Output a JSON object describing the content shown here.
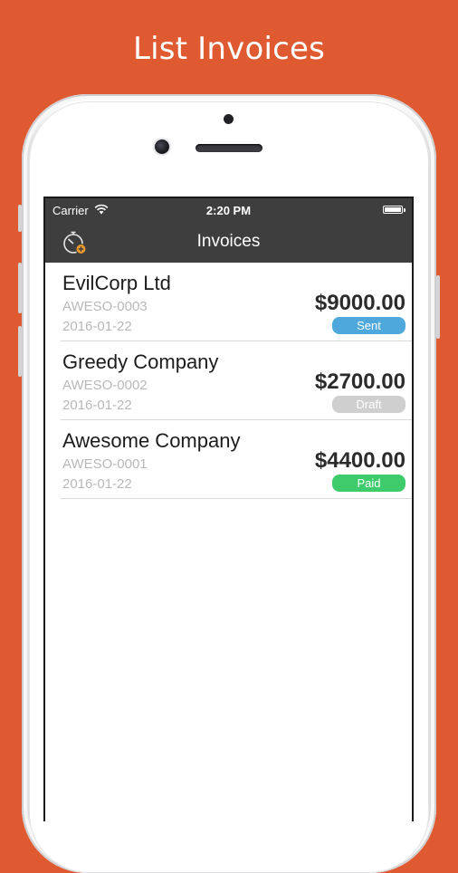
{
  "headline": "List Invoices",
  "status_bar": {
    "carrier": "Carrier",
    "time": "2:20 PM"
  },
  "nav": {
    "title": "Invoices",
    "left_icon": "timer-add-icon"
  },
  "invoices": [
    {
      "client": "EvilCorp Ltd",
      "number": "AWESO-0003",
      "date": "2016-01-22",
      "amount": "$9000.00",
      "status": "Sent",
      "status_color": "#4ea8dc"
    },
    {
      "client": "Greedy Company",
      "number": "AWESO-0002",
      "date": "2016-01-22",
      "amount": "$2700.00",
      "status": "Draft",
      "status_color": "#cfcfcf"
    },
    {
      "client": "Awesome Company",
      "number": "AWESO-0001",
      "date": "2016-01-22",
      "amount": "$4400.00",
      "status": "Paid",
      "status_color": "#3ecb6b"
    }
  ],
  "colors": {
    "background": "#e05a31",
    "navbar": "#3e3e3e",
    "accent": "#e89a2c"
  }
}
